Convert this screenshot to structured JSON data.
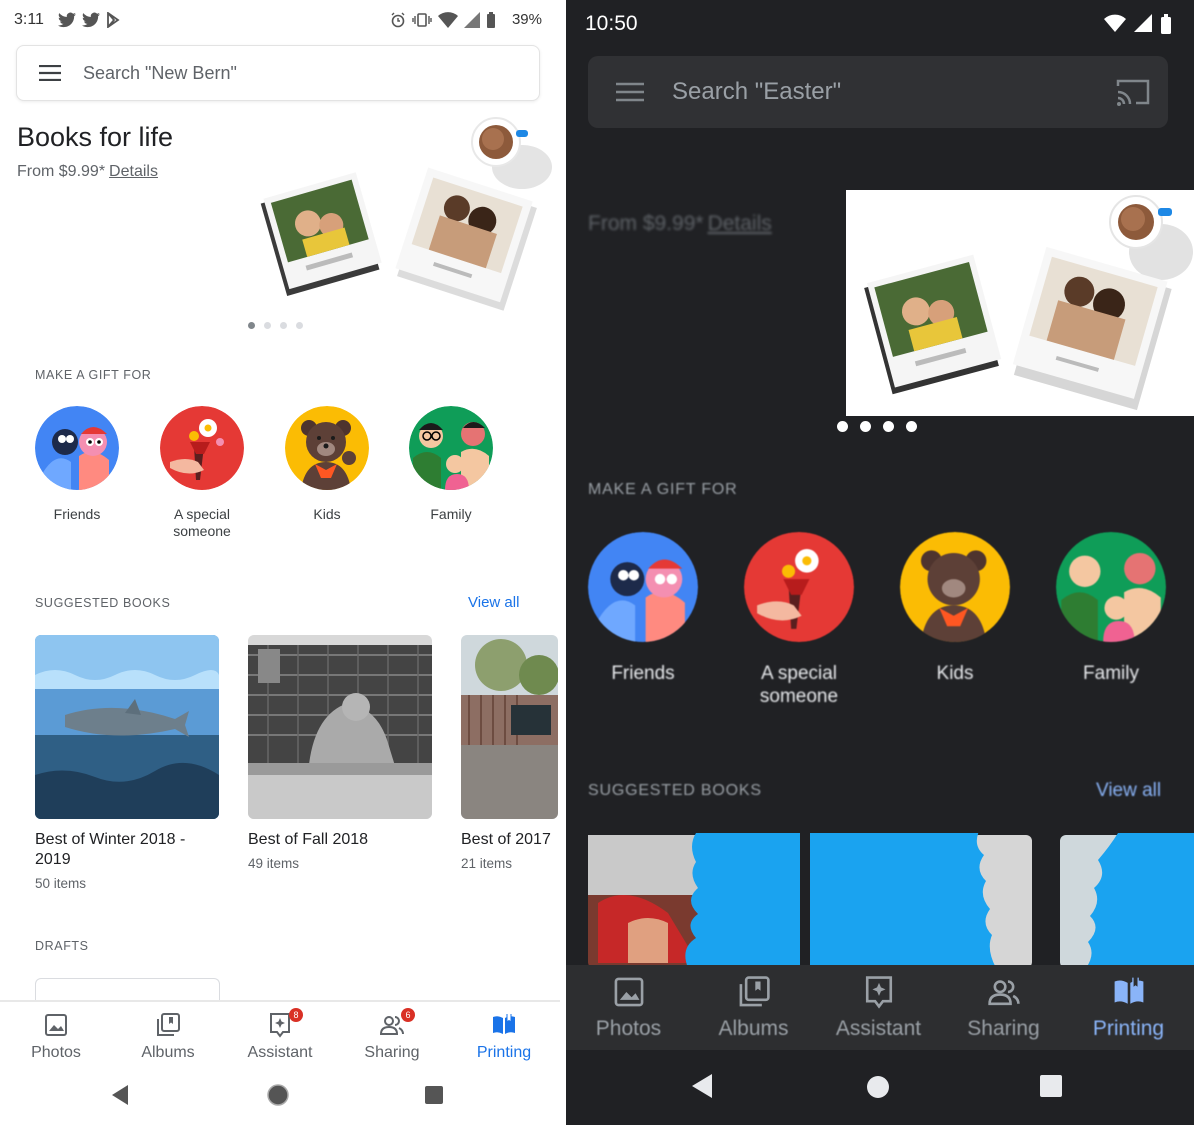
{
  "light": {
    "status": {
      "time": "3:11",
      "battery": "39%"
    },
    "search": {
      "placeholder": "Search \"New Bern\""
    },
    "hero": {
      "title": "Books for life",
      "price": "From $9.99*",
      "details": "Details"
    },
    "gift_section": {
      "label": "MAKE A GIFT FOR",
      "items": [
        {
          "label": "Friends"
        },
        {
          "label": "A special someone"
        },
        {
          "label": "Kids"
        },
        {
          "label": "Family"
        }
      ]
    },
    "suggested": {
      "label": "SUGGESTED BOOKS",
      "view_all": "View all",
      "books": [
        {
          "title": "Best of Winter 2018 - 2019",
          "count": "50 items"
        },
        {
          "title": "Best of Fall 2018",
          "count": "49 items"
        },
        {
          "title": "Best of 2017",
          "count": "21 items"
        }
      ]
    },
    "drafts": {
      "label": "DRAFTS"
    },
    "nav": {
      "items": [
        {
          "label": "Photos"
        },
        {
          "label": "Albums"
        },
        {
          "label": "Assistant",
          "badge": "8"
        },
        {
          "label": "Sharing",
          "badge": "6"
        },
        {
          "label": "Printing"
        }
      ]
    }
  },
  "dark": {
    "status": {
      "time": "10:50"
    },
    "search": {
      "placeholder": "Search \"Easter\""
    },
    "hero": {
      "price": "From $9.99*",
      "details": "Details"
    },
    "gift_section": {
      "label": "MAKE A GIFT FOR",
      "items": [
        {
          "label": "Friends"
        },
        {
          "label": "A special someone"
        },
        {
          "label": "Kids"
        },
        {
          "label": "Family"
        }
      ]
    },
    "suggested": {
      "label": "SUGGESTED BOOKS",
      "view_all": "View all"
    },
    "nav": {
      "items": [
        {
          "label": "Photos"
        },
        {
          "label": "Albums"
        },
        {
          "label": "Assistant"
        },
        {
          "label": "Sharing"
        },
        {
          "label": "Printing"
        }
      ]
    }
  },
  "colors": {
    "accent_light": "#1a73e8",
    "accent_dark": "#8ab4f8",
    "badge": "#d93025",
    "dark_bg": "#202124"
  }
}
